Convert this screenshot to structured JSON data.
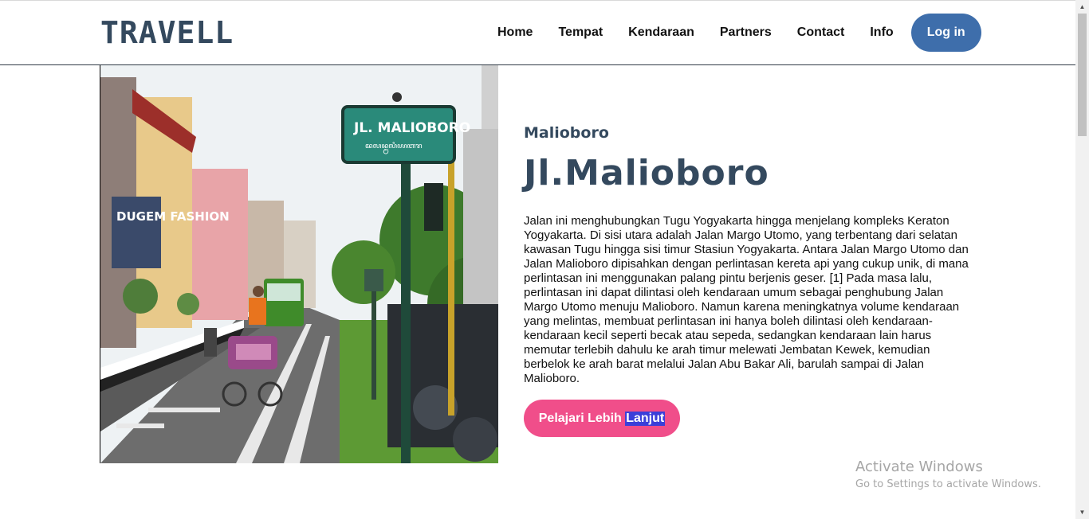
{
  "header": {
    "logo": "TRAVELL",
    "nav": [
      "Home",
      "Tempat",
      "Kendaraan",
      "Partners",
      "Contact",
      "Info"
    ],
    "login_label": "Log in"
  },
  "hero": {
    "image": {
      "sign_text": "JL. MALIOBORO",
      "sign_subtext": "ꦢꦭꦤ꧀ꦩꦭꦶꦪꦧꦫ",
      "shop_sign": "DUGEM FASHION"
    },
    "subtitle": "Malioboro",
    "title": "Jl.Malioboro",
    "description": "Jalan ini menghubungkan Tugu Yogyakarta hingga menjelang kompleks Keraton Yogyakarta. Di sisi utara adalah Jalan Margo Utomo, yang terbentang dari selatan kawasan Tugu hingga sisi timur Stasiun Yogyakarta. Antara Jalan Margo Utomo dan Jalan Malioboro dipisahkan dengan perlintasan kereta api yang cukup unik, di mana perlintasan ini menggunakan palang pintu berjenis geser. [1] Pada masa lalu, perlintasan ini dapat dilintasi oleh kendaraan umum sebagai penghubung Jalan Margo Utomo menuju Malioboro. Namun karena meningkatnya volume kendaraan yang melintas, membuat perlintasan ini hanya boleh dilintasi oleh kendaraan-kendaraan kecil seperti becak atau sepeda, sedangkan kendaraan lain harus memutar terlebih dahulu ke arah timur melewati Jembatan Kewek, kemudian berbelok ke arah barat melalui Jalan Abu Bakar Ali, barulah sampai di Jalan Malioboro.",
    "cta_prefix": "Pelajari Lebih ",
    "cta_selected": "Lanjut"
  },
  "watermark": {
    "title": "Activate Windows",
    "subtitle": "Go to Settings to activate Windows."
  },
  "colors": {
    "brand": "#34495e",
    "login_button": "#3e6eab",
    "cta_button": "#f04e8a",
    "text_selection": "#3b3fd9"
  }
}
